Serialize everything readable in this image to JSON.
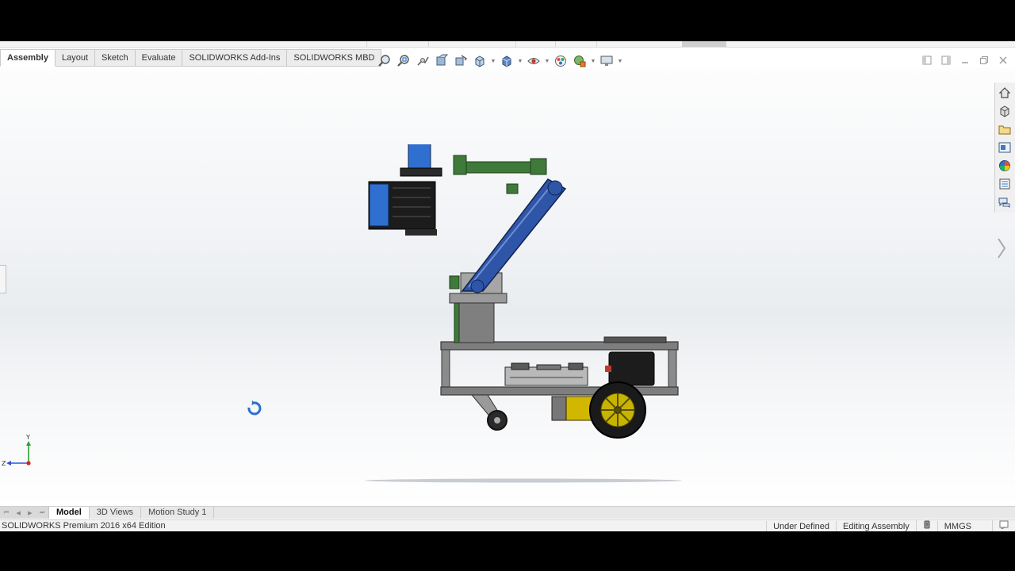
{
  "command_manager": {
    "tabs": [
      {
        "label": "Assembly",
        "active": true
      },
      {
        "label": "Layout",
        "active": false
      },
      {
        "label": "Sketch",
        "active": false
      },
      {
        "label": "Evaluate",
        "active": false
      },
      {
        "label": "SOLIDWORKS Add-Ins",
        "active": false
      },
      {
        "label": "SOLIDWORKS MBD",
        "active": false
      }
    ]
  },
  "heads_up_toolbar": {
    "icons": [
      "zoom-to-fit-icon",
      "zoom-to-area-icon",
      "previous-view-icon",
      "section-view-icon",
      "dynamic-annotation-icon",
      "view-orientation-icon",
      "display-style-icon",
      "hide-show-items-icon",
      "edit-appearance-icon",
      "apply-scene-icon",
      "view-settings-icon"
    ]
  },
  "task_pane": {
    "icons": [
      "home-icon",
      "3d-content-icon",
      "design-library-icon",
      "file-explorer-icon",
      "appearances-icon",
      "custom-properties-icon",
      "forum-icon"
    ]
  },
  "bottom_tabs": [
    {
      "label": "Model",
      "active": true
    },
    {
      "label": "3D Views",
      "active": false
    },
    {
      "label": "Motion Study 1",
      "active": false
    }
  ],
  "status_bar": {
    "edition": "SOLIDWORKS Premium 2016 x64 Edition",
    "definition": "Under Defined",
    "mode": "Editing Assembly",
    "units": "MMGS"
  },
  "triad": {
    "y_label": "Y",
    "z_label": "Z"
  },
  "colors": {
    "arm_blue": "#2f55a8",
    "bracket_green": "#3f7a3a",
    "chassis_gray": "#808080",
    "wheel_yellow": "#c8b400"
  }
}
